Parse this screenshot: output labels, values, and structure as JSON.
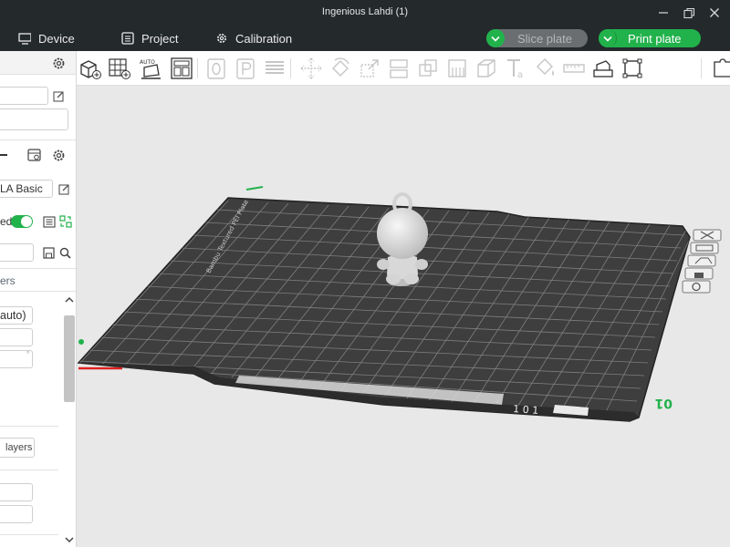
{
  "window": {
    "title": "Ingenious Lahdi (1)"
  },
  "menubar": {
    "device_label": "Device",
    "project_label": "Project",
    "calibration_label": "Calibration",
    "slice_label": "Slice plate",
    "print_label": "Print plate"
  },
  "left_panel": {
    "filament_name": "LA Basic",
    "toggle_label": "ed",
    "section_label": "ers",
    "field_auto": "auto)",
    "layers_button": "layers"
  },
  "plate": {
    "front_label": "01",
    "number_label": "1 0 1"
  },
  "colors": {
    "accent": "#21b24b",
    "titlebar": "#24292c",
    "plate": "#3f3f3f"
  }
}
